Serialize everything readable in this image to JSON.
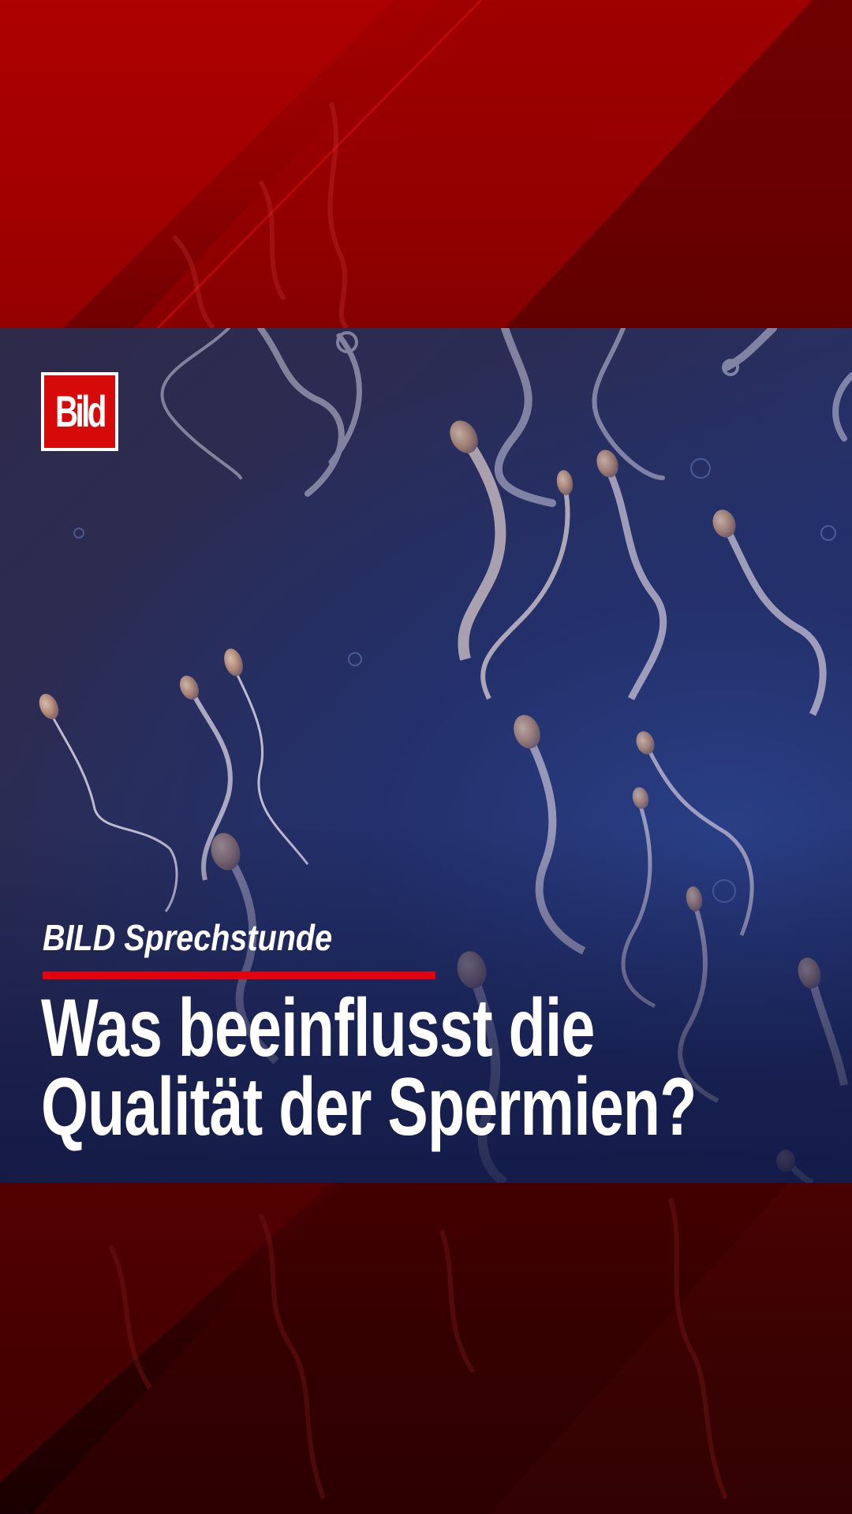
{
  "logo": {
    "text": "Bild",
    "color": "#d70a0a"
  },
  "kicker": {
    "text": "BILD Sprechstunde",
    "rule_color": "#e3000f"
  },
  "headline": {
    "line1": "Was beeinflusst die",
    "line2": "Qualität der Spermien?"
  },
  "colors": {
    "band_red": "#a40000",
    "band_dark": "#2e0000",
    "photo_blue": "#253574",
    "text": "#ffffff"
  }
}
